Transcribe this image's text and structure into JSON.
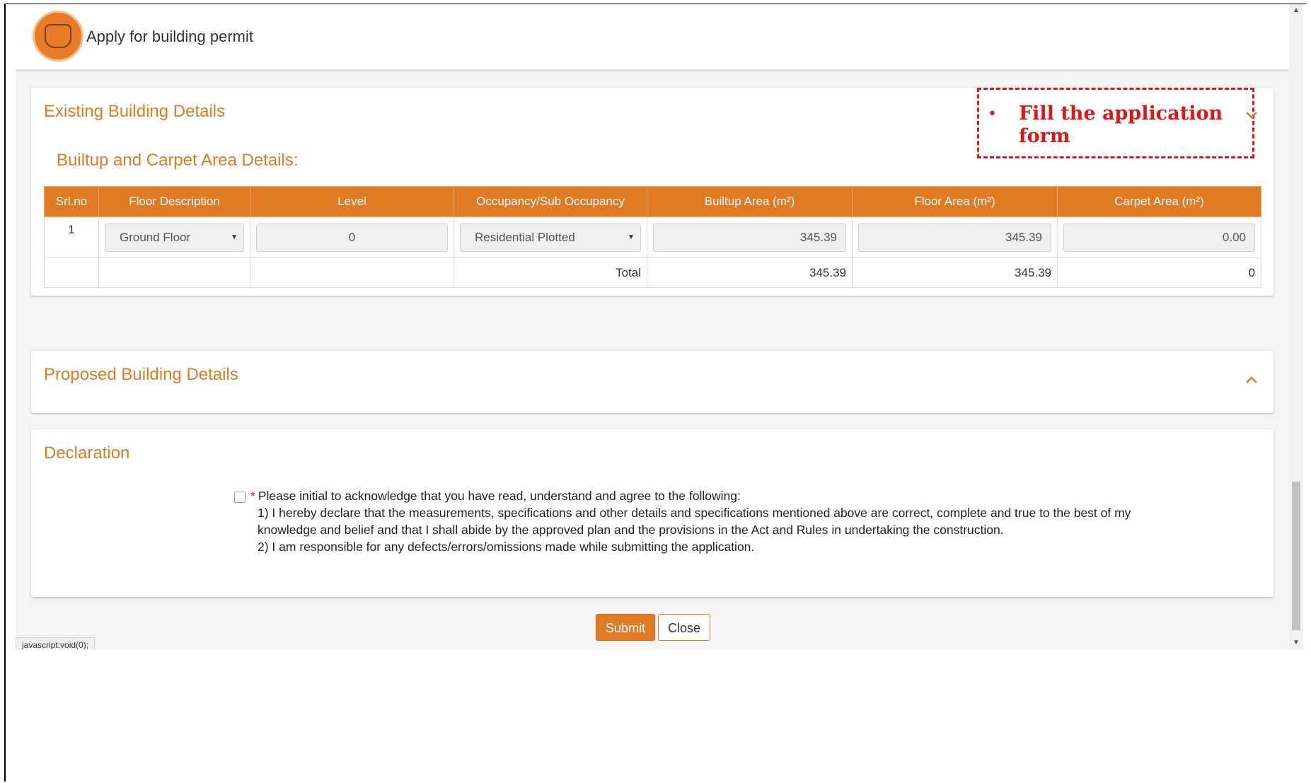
{
  "header": {
    "title": "Apply for building permit"
  },
  "existing": {
    "title": "Existing Building Details",
    "subtitle": "Builtup and Carpet Area Details:",
    "columns": [
      "Srl.no",
      "Floor Description",
      "Level",
      "Occupancy/Sub Occupancy",
      "Builtup Area (m²)",
      "Floor Area (m²)",
      "Carpet Area (m²)"
    ],
    "rows": [
      {
        "srl": "1",
        "floor": "Ground Floor",
        "level": "0",
        "occupancy": "Residential Plotted",
        "builtup": "345.39",
        "floor_area": "345.39",
        "carpet": "0.00"
      }
    ],
    "total": {
      "label": "Total",
      "builtup": "345.39",
      "floor_area": "345.39",
      "carpet": "0"
    }
  },
  "annotation": {
    "bullet": "•",
    "text": "Fill the application form"
  },
  "proposed": {
    "title": "Proposed Building Details"
  },
  "declaration": {
    "title": "Declaration",
    "required_mark": "*",
    "intro": "Please initial to acknowledge that you have read, understand and agree to the following:",
    "line1": "1) I hereby declare that the measurements, specifications and other details and specifications mentioned above are correct, complete and true to the best of my knowledge and belief and that I shall abide by the approved plan and the provisions in the Act and Rules in undertaking the construction.",
    "line2": "2) I am responsible for any defects/errors/omissions made while submitting the application.",
    "checked": false
  },
  "actions": {
    "submit_label": "Submit",
    "close_label": "Close"
  },
  "status_bar": {
    "text": "javascript:void(0);"
  },
  "colors": {
    "accent": "#e07b24",
    "annotation": "#e01616"
  }
}
